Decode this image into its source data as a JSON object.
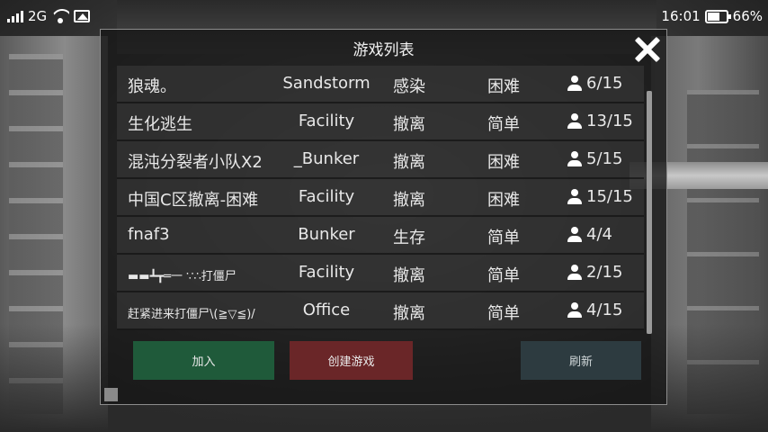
{
  "status_bar": {
    "network": "2G",
    "time": "16:01",
    "battery": "66%"
  },
  "dialog": {
    "title": "游戏列表"
  },
  "rooms": [
    {
      "name": "狼魂。",
      "map": "Sandstorm",
      "mode": "感染",
      "difficulty": "困难",
      "players": "6/15"
    },
    {
      "name": "生化逃生",
      "map": "Facility",
      "mode": "撤离",
      "difficulty": "简单",
      "players": "13/15"
    },
    {
      "name": "混沌分裂者小队X2",
      "map": "_Bunker",
      "mode": "撤离",
      "difficulty": "困难",
      "players": "5/15"
    },
    {
      "name": "中国C区撤离-困难",
      "map": "Facility",
      "mode": "撤离",
      "difficulty": "困难",
      "players": "15/15"
    },
    {
      "name": "fnaf3",
      "map": "Bunker",
      "mode": "生存",
      "difficulty": "简单",
      "players": "4/4"
    },
    {
      "name": "▬▬┻┳═一 ∵∴打僵尸",
      "map": "Facility",
      "mode": "撤离",
      "difficulty": "简单",
      "players": "2/15"
    },
    {
      "name": "赶紧进来打僵尸\\(≧▽≦)/",
      "map": "Office",
      "mode": "撤离",
      "difficulty": "简单",
      "players": "4/15"
    }
  ],
  "buttons": {
    "join": "加入",
    "create": "创建游戏",
    "refresh": "刷新"
  },
  "colors": {
    "join": "#1f5a3a",
    "create": "#6a2628",
    "refresh": "#2d3b40"
  }
}
